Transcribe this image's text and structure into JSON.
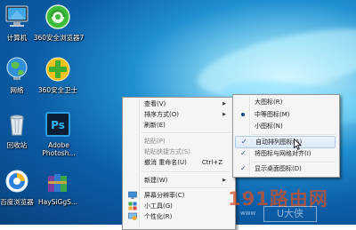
{
  "desktop": {
    "icons": [
      {
        "label": "计算机"
      },
      {
        "label": "360安全浏览器7"
      },
      {
        "label": "网络"
      },
      {
        "label": "360安全卫士"
      },
      {
        "label": "回收站"
      },
      {
        "label": "Adobe Photosh..."
      },
      {
        "label": "百度浏览器"
      },
      {
        "label": "HaySiGgS..."
      }
    ]
  },
  "context_menu": {
    "items": [
      {
        "label": "查看(V)",
        "has_submenu": true
      },
      {
        "label": "排序方式(O)",
        "has_submenu": true
      },
      {
        "label": "刷新(E)"
      },
      {
        "label": "粘贴(P)",
        "disabled": true
      },
      {
        "label": "粘贴快捷方式(S)",
        "disabled": true
      },
      {
        "label": "撤消 重命名(U)",
        "shortcut": "Ctrl+Z"
      },
      {
        "label": "新建(W)",
        "has_submenu": true
      },
      {
        "label": "屏幕分辨率(C)",
        "icon": "display-icon"
      },
      {
        "label": "小工具(G)",
        "icon": "gadgets-icon"
      },
      {
        "label": "个性化(R)",
        "icon": "personalize-icon"
      }
    ]
  },
  "view_submenu": {
    "items": [
      {
        "label": "大图标(R)"
      },
      {
        "label": "中等图标(M)",
        "selected": true
      },
      {
        "label": "小图标(N)"
      },
      {
        "label": "自动排列图标(A)",
        "checked": true,
        "highlighted": true
      },
      {
        "label": "将图标与网格对齐(I)",
        "checked": true
      },
      {
        "label": "显示桌面图标(D)",
        "checked": true
      }
    ]
  },
  "watermark": {
    "text": "191路由网",
    "badge": "U大侠",
    "sub": "www"
  },
  "colors": {
    "wallpaper": "#0c5ea8",
    "menu_bg": "#f5f5f5",
    "highlight": "#dbe8f8",
    "check": "#1a3f8a"
  }
}
